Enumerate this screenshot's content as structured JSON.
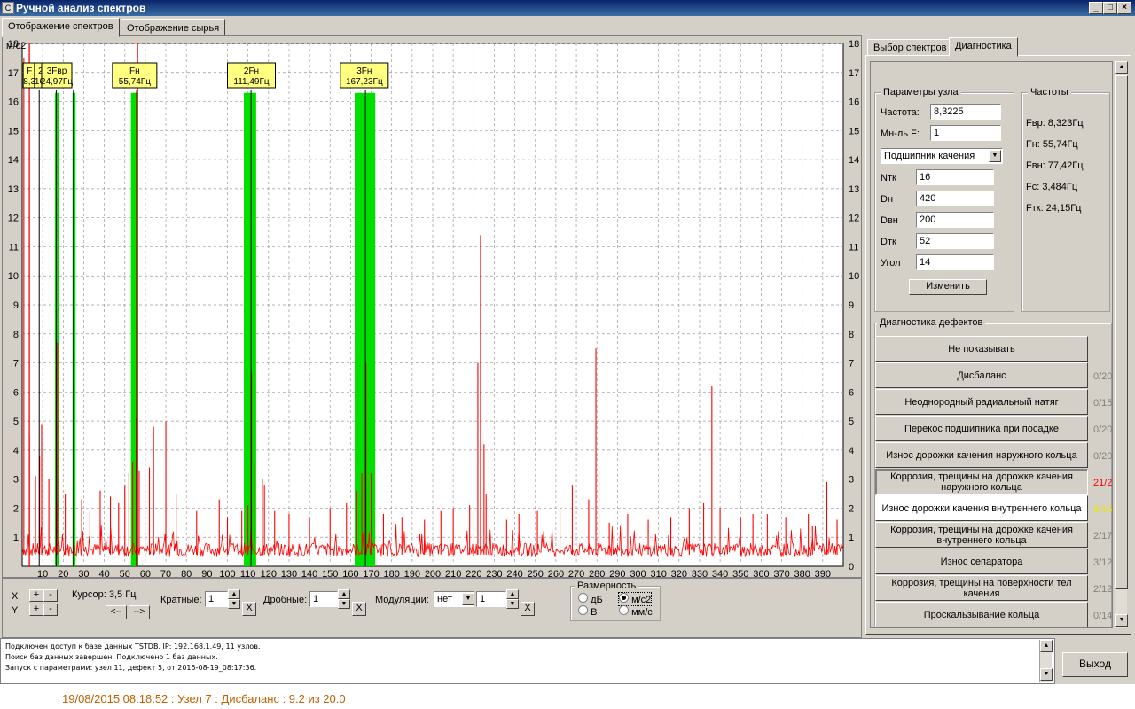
{
  "window": {
    "title": "Ручной анализ спектров",
    "app_icon": "app-icon"
  },
  "tabs": {
    "left": [
      "Отображение спектров",
      "Отображение сырья"
    ],
    "right": [
      "Выбор спектров",
      "Диагностика"
    ]
  },
  "chart_data": {
    "type": "line",
    "yunit": "м/с2",
    "xlim": [
      0,
      400
    ],
    "ylim": [
      0,
      18
    ],
    "xticks": [
      10,
      20,
      30,
      40,
      50,
      60,
      70,
      80,
      90,
      100,
      110,
      120,
      130,
      140,
      150,
      160,
      170,
      180,
      190,
      200,
      210,
      220,
      230,
      240,
      250,
      260,
      270,
      280,
      290,
      300,
      310,
      320,
      330,
      340,
      350,
      360,
      370,
      380,
      390
    ],
    "yticks": [
      1,
      2,
      3,
      4,
      5,
      6,
      7,
      8,
      9,
      10,
      11,
      12,
      13,
      14,
      15,
      16,
      17,
      18
    ],
    "bands": [
      [
        16,
        18
      ],
      [
        24.5,
        26
      ],
      [
        53,
        56.5
      ],
      [
        108,
        114
      ],
      [
        162,
        172
      ]
    ],
    "band_color": "#00e000",
    "markers": [
      {
        "label": "F",
        "value": "8,3",
        "x": 8.3
      },
      {
        "label": "2",
        "value": "16,",
        "x": 16.6
      },
      {
        "label": "3Fвр",
        "value": "24,97Гц",
        "x": 24.97
      },
      {
        "label": "Fн",
        "value": "55,74Гц",
        "x": 55.74
      },
      {
        "label": "2Fн",
        "value": "111,49Гц",
        "x": 111.49
      },
      {
        "label": "3Fн",
        "value": "167,23Гц",
        "x": 167.23
      }
    ],
    "cursor_lines": [
      3.5,
      56.2
    ],
    "series": [
      {
        "color": "#ff0000",
        "peaks": [
          [
            0.8,
            17.5
          ],
          [
            3.5,
            4.5
          ],
          [
            6.5,
            3.1
          ],
          [
            8.5,
            3.8
          ],
          [
            9.5,
            4.9
          ],
          [
            13,
            3.0
          ],
          [
            16.8,
            2.2
          ],
          [
            17.2,
            7.7
          ],
          [
            21,
            2.5
          ],
          [
            25,
            1.8
          ],
          [
            29,
            2.3
          ],
          [
            33,
            1.9
          ],
          [
            38,
            2.6
          ],
          [
            43,
            2.4
          ],
          [
            47,
            2.2
          ],
          [
            50,
            2.8
          ],
          [
            52,
            3.2
          ],
          [
            53.8,
            3.6
          ],
          [
            55.6,
            5.1
          ],
          [
            57,
            3.3
          ],
          [
            62,
            3.4
          ],
          [
            64,
            4.8
          ],
          [
            70,
            5.0
          ],
          [
            75,
            2.5
          ],
          [
            85,
            1.9
          ],
          [
            96,
            2.3
          ],
          [
            100,
            1.7
          ],
          [
            107,
            1.9
          ],
          [
            110,
            2.1
          ],
          [
            111.7,
            6.7
          ],
          [
            113,
            3.6
          ],
          [
            117,
            3.0
          ],
          [
            118,
            2.8
          ],
          [
            123,
            1.9
          ],
          [
            130,
            1.8
          ],
          [
            140,
            1.7
          ],
          [
            150,
            2.0
          ],
          [
            158,
            2.2
          ],
          [
            163,
            2.6
          ],
          [
            165.5,
            3.2
          ],
          [
            167.5,
            7.0
          ],
          [
            170,
            3.2
          ],
          [
            176,
            1.8
          ],
          [
            185,
            1.7
          ],
          [
            196,
            1.6
          ],
          [
            204,
            1.9
          ],
          [
            210,
            2.0
          ],
          [
            218,
            2.1
          ],
          [
            222,
            7.0
          ],
          [
            223.3,
            11.4
          ],
          [
            225,
            4.2
          ],
          [
            226,
            2.5
          ],
          [
            236,
            1.6
          ],
          [
            242,
            1.8
          ],
          [
            251,
            1.9
          ],
          [
            262,
            2.0
          ],
          [
            268,
            2.8
          ],
          [
            276,
            2.3
          ],
          [
            279.5,
            7.5
          ],
          [
            281,
            3.3
          ],
          [
            286,
            1.5
          ],
          [
            295,
            1.8
          ],
          [
            305,
            1.6
          ],
          [
            316,
            1.7
          ],
          [
            325,
            2.0
          ],
          [
            332,
            2.2
          ],
          [
            336,
            6.2
          ],
          [
            340,
            2.0
          ],
          [
            350,
            1.7
          ],
          [
            356,
            1.8
          ],
          [
            363,
            1.8
          ],
          [
            372,
            1.7
          ],
          [
            383,
            1.8
          ],
          [
            385,
            1.4
          ],
          [
            392,
            2.9
          ],
          [
            397,
            1.6
          ]
        ]
      }
    ]
  },
  "controls": {
    "x_label": "X",
    "y_label": "Y",
    "plus": "+",
    "minus": "-",
    "cursor_label": "Курсор: 3,5 Гц",
    "left_arrow": "<--",
    "right_arrow": "-->",
    "multiples_label": "Кратные:",
    "multiples_value": "1",
    "fractions_label": "Дробные:",
    "fractions_value": "1",
    "mod_label": "Модуляции:",
    "mod_value": "нет",
    "mod_count": "1",
    "clear": "X",
    "dim_title": "Размерность",
    "dim_options": [
      "дБ",
      "м/с2",
      "В",
      "мм/с"
    ],
    "dim_selected": "м/с2"
  },
  "node_params": {
    "title": "Параметры узла",
    "freq_label": "Частота:",
    "freq_value": "8,3225",
    "mult_label": "Мн-ль F:",
    "mult_value": "1",
    "bearing_type": "Подшипник качения",
    "fields": [
      {
        "label": "Nтк",
        "value": "16"
      },
      {
        "label": "Dн",
        "value": "420"
      },
      {
        "label": "Dвн",
        "value": "200"
      },
      {
        "label": "Dтк",
        "value": "52"
      },
      {
        "label": "Угол",
        "value": "14"
      }
    ],
    "change_btn": "Изменить"
  },
  "frequencies": {
    "title": "Частоты",
    "items": [
      "Fвр: 8,323Гц",
      "Fн: 55,74Гц",
      "Fвн: 77,42Гц",
      "Fс: 3,484Гц",
      "Fтк: 24,15Гц"
    ]
  },
  "defects": {
    "title": "Диагностика дефектов",
    "items": [
      {
        "label": "Не показывать",
        "count": "",
        "color": "#000"
      },
      {
        "label": "Дисбаланс",
        "count": "0/20",
        "color": "#808080"
      },
      {
        "label": "Неоднородный радиальный натяг",
        "count": "0/15",
        "color": "#808080"
      },
      {
        "label": "Перекос подшипника при посадке",
        "count": "0/20",
        "color": "#808080"
      },
      {
        "label": "Износ дорожки качения наружного кольца",
        "count": "0/20",
        "color": "#808080"
      },
      {
        "label": "Коррозия, трещины на дорожке качения наружного кольца",
        "count": "21/2",
        "color": "#ff0000"
      },
      {
        "label": "Износ дорожки качения внутреннего кольца",
        "count": "9/15",
        "color": "#e8e800"
      },
      {
        "label": "Коррозия, трещины на дорожке качения внутреннего кольца",
        "count": "2/17",
        "color": "#808080"
      },
      {
        "label": "Износ сепаратора",
        "count": "3/12",
        "color": "#808080"
      },
      {
        "label": "Коррозия, трещины на поверхности тел качения",
        "count": "2/12",
        "color": "#808080"
      },
      {
        "label": "Проскальзывание кольца",
        "count": "0/14",
        "color": "#808080"
      }
    ]
  },
  "log": [
    "Подключен доступ к базе данных TSTDB. IP: 192.168.1.49, 11 узлов.",
    "Поиск баз данных завершен. Подключено 1 баз данных.",
    "Запуск с параметрами: узел 11, дефект 5, от 2015-08-19_08:17:36."
  ],
  "exit_btn": "Выход",
  "status_line": "19/08/2015 08:18:52 : Узел 7 : Дисбаланс : 9.2 из 20.0"
}
